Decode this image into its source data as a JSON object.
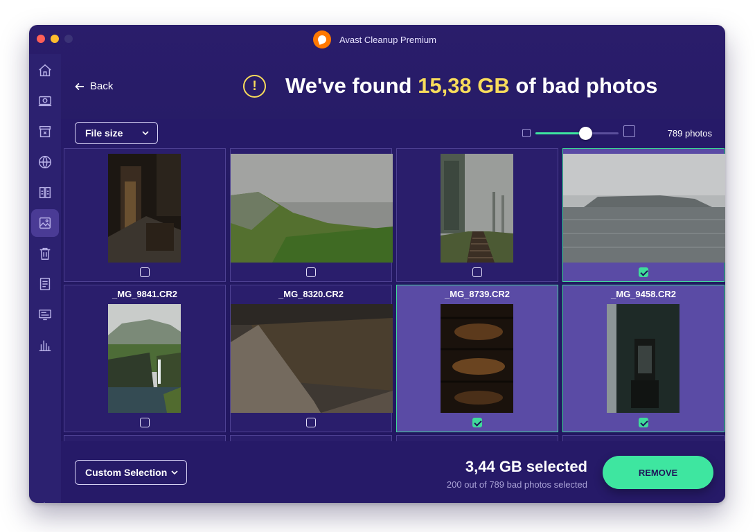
{
  "window": {
    "title": "Avast Cleanup Premium"
  },
  "sidebar": {
    "items": [
      {
        "icon": "home-icon"
      },
      {
        "icon": "maintenance-icon"
      },
      {
        "icon": "disk-cleanup-icon"
      },
      {
        "icon": "browser-cleanup-icon"
      },
      {
        "icon": "duplicates-icon"
      },
      {
        "icon": "photos-icon",
        "active": true
      },
      {
        "icon": "trash-icon"
      },
      {
        "icon": "apps-icon"
      },
      {
        "icon": "software-updater-icon"
      },
      {
        "icon": "statistics-icon"
      }
    ],
    "settings_icon": "gear-icon"
  },
  "header": {
    "back_label": "Back",
    "headline_prefix": "We've found ",
    "headline_highlight": "15,38 GB",
    "headline_suffix": " of bad photos",
    "accent_color": "#f8dc5b"
  },
  "toolbar": {
    "sort_label": "File size",
    "zoom_level": 0.6,
    "photo_count": "789 photos"
  },
  "grid": {
    "rows": [
      [
        {
          "name": "",
          "checked": false,
          "photo": "dark-corridor"
        },
        {
          "name": "",
          "checked": false,
          "photo": "foggy-cliff"
        },
        {
          "name": "",
          "checked": false,
          "photo": "foggy-stairs"
        },
        {
          "name": "",
          "checked": true,
          "photo": "sea-island"
        }
      ],
      [
        {
          "name": "_MG_9841.CR2",
          "checked": false,
          "photo": "waterfall-cliff"
        },
        {
          "name": "_MG_8320.CR2",
          "checked": false,
          "photo": "stone-pit"
        },
        {
          "name": "_MG_8739.CR2",
          "checked": true,
          "photo": "dark-panels"
        },
        {
          "name": "_MG_9458.CR2",
          "checked": true,
          "photo": "dark-room"
        }
      ]
    ]
  },
  "footer": {
    "selection_dropdown": "Custom Selection",
    "selected_size": "3,44 GB selected",
    "selected_detail": "200 out of 789 bad photos selected",
    "remove_label": "REMOVE",
    "button_color": "#3ee6a0"
  }
}
